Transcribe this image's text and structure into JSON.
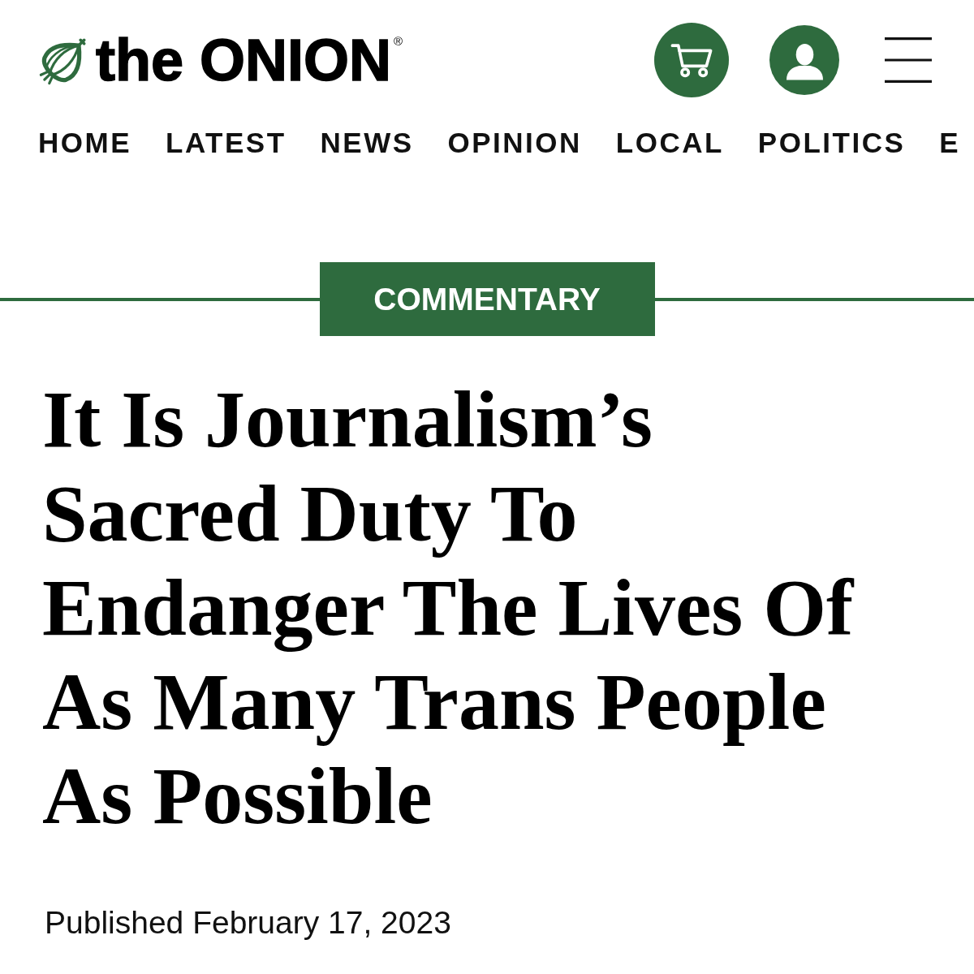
{
  "header": {
    "logo": {
      "wordmark": "the ONION",
      "registered_mark": "®"
    }
  },
  "nav": {
    "items": [
      "HOME",
      "LATEST",
      "NEWS",
      "OPINION",
      "LOCAL",
      "POLITICS",
      "E"
    ]
  },
  "article": {
    "section": "COMMENTARY",
    "headline": "It Is Journalism’s Sacred Duty To Endanger The Lives Of As Many Trans People As Possible",
    "published": "Published February 17, 2023"
  }
}
